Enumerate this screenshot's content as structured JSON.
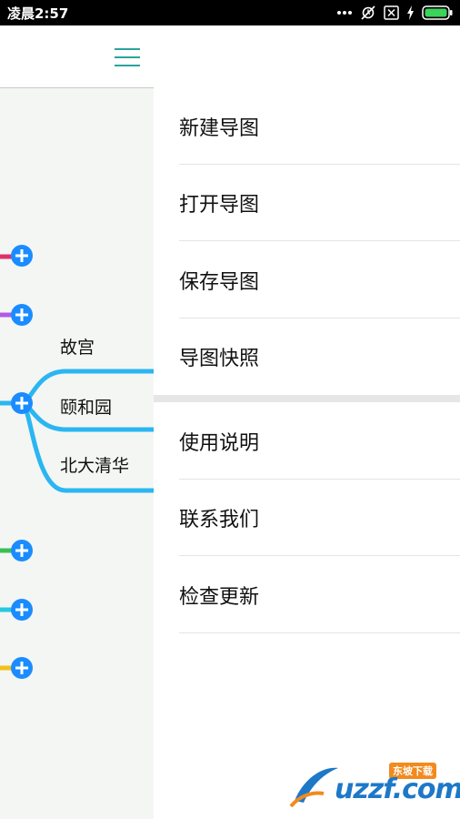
{
  "status_bar": {
    "time": "凌晨2:57",
    "icons": [
      "more-dots-icon",
      "mute-alarm-icon",
      "no-sim-icon",
      "charging-icon",
      "battery-icon"
    ]
  },
  "map": {
    "nodes": [
      {
        "label": "故宫"
      },
      {
        "label": "颐和园"
      },
      {
        "label": "北大清华"
      }
    ],
    "branch_colors": [
      "#e0306a",
      "#b05ae8",
      "#2bb6f2",
      "#3bbf54",
      "#26c9e0",
      "#f2c21b"
    ],
    "accent": "#1a8cff"
  },
  "drawer": {
    "items": [
      {
        "label": "新建导图"
      },
      {
        "label": "打开导图"
      },
      {
        "label": "保存导图"
      },
      {
        "label": "导图快照"
      },
      {
        "label": "使用说明"
      },
      {
        "label": "联系我们"
      },
      {
        "label": "检查更新"
      }
    ]
  },
  "watermark": {
    "brand": "uzzf.com",
    "badge": "东坡下载"
  }
}
